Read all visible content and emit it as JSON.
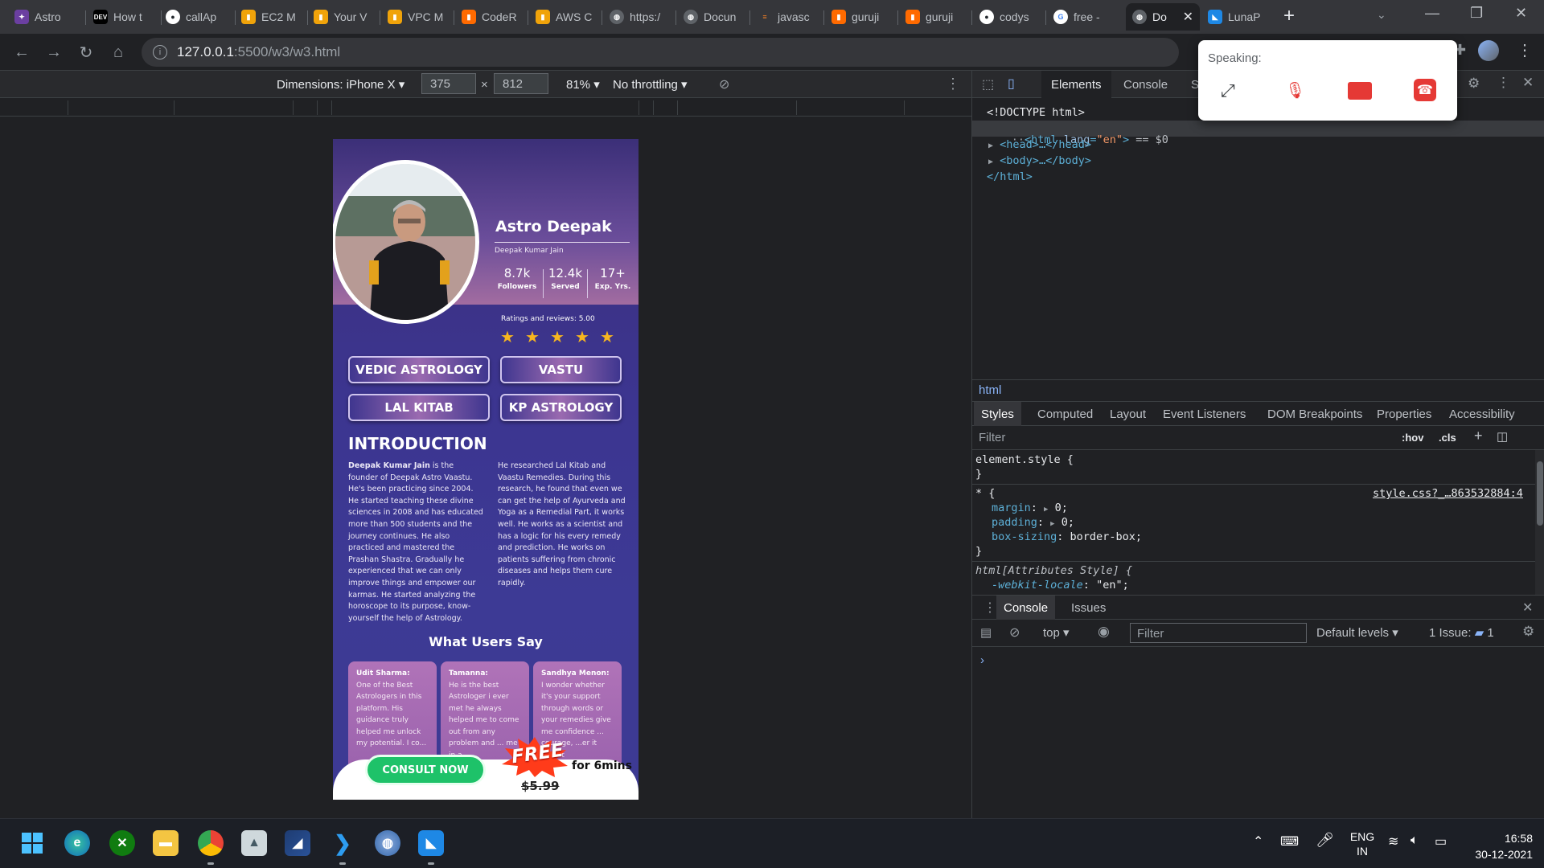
{
  "browser": {
    "tabs": [
      {
        "label": "Astro",
        "icon": "astro-favicon",
        "color": "#6b3fa0"
      },
      {
        "label": "How t",
        "icon": "dev-favicon",
        "color": "#000000"
      },
      {
        "label": "callAp",
        "icon": "github-favicon",
        "color": "#24292e"
      },
      {
        "label": "EC2 M",
        "icon": "aws-favicon",
        "color": "#f0a30a"
      },
      {
        "label": "Your V",
        "icon": "aws-favicon",
        "color": "#f0a30a"
      },
      {
        "label": "VPC M",
        "icon": "aws-favicon",
        "color": "#f0a30a"
      },
      {
        "label": "CodeR",
        "icon": "aws-favicon",
        "color": "#ff6a00"
      },
      {
        "label": "AWS C",
        "icon": "aws-favicon",
        "color": "#f0a30a"
      },
      {
        "label": "https:/",
        "icon": "globe-favicon",
        "color": "#5f6368"
      },
      {
        "label": "Docun",
        "icon": "globe-favicon",
        "color": "#5f6368"
      },
      {
        "label": "javasc",
        "icon": "stackoverflow-favicon",
        "color": "#f48024"
      },
      {
        "label": "guruji",
        "icon": "aws-favicon",
        "color": "#ff6a00"
      },
      {
        "label": "guruji",
        "icon": "aws-favicon",
        "color": "#ff6a00"
      },
      {
        "label": "codys",
        "icon": "github-favicon",
        "color": "#24292e"
      },
      {
        "label": "free -",
        "icon": "google-favicon",
        "color": "#ffffff"
      },
      {
        "label": "Do",
        "icon": "globe-favicon",
        "color": "#5f6368"
      },
      {
        "label": "LunaP",
        "icon": "luna-favicon",
        "color": "#1e88e5"
      }
    ],
    "dev_label": "DEV",
    "new_tab": "+",
    "url_host": "127.0.0.1",
    "url_path": ":5500/w3/w3.html"
  },
  "device_toolbar": {
    "dimensions_label": "Dimensions: iPhone X",
    "width": "375",
    "x": "×",
    "height": "812",
    "zoom": "81%",
    "throttling": "No throttling"
  },
  "page": {
    "name": "Astro Deepak",
    "subname": "Deepak Kumar Jain",
    "stats": [
      {
        "value": "8.7k",
        "label": "Followers"
      },
      {
        "value": "12.4k",
        "label": "Served"
      },
      {
        "value": "17+",
        "label": "Exp. Yrs."
      }
    ],
    "ratings_text": "Ratings and reviews: 5.00",
    "rating_value": 5,
    "stars": [
      "★",
      "★",
      "★",
      "★",
      "★"
    ],
    "services": [
      "VEDIC ASTROLOGY",
      "VASTU",
      "LAL KITAB",
      "KP ASTROLOGY"
    ],
    "intro_heading": "INTRODUCTION",
    "intro_bold": "Deepak Kumar Jain",
    "intro_col1": " is the founder of Deepak Astro Vaastu. He's been practicing since 2004. He started teaching these divine sciences in 2008 and has educated more than 500 students and the journey continues. He also practiced and mastered the Prashan Shastra. Gradually he experienced that we can only improve things and empower our karmas. He started analyzing the horoscope to its purpose, know-yourself the help of Astrology.",
    "intro_col2": "He researched Lal Kitab and Vaastu Remedies. During this research, he found that even we can get the help of Ayurveda and Yoga as a Remedial Part, it works well. He works as a scientist and has a logic for his every remedy and prediction. He works on patients suffering from chronic diseases and helps them cure rapidly.",
    "reviews_heading": "What Users Say",
    "reviews": [
      {
        "name": "Udit Sharma:",
        "text": "One of the Best Astrologers in this platform. His guidance truly helped me unlock my potential. I co..."
      },
      {
        "name": "Tamanna:",
        "text": "He is the best Astrologer i ever met he always helped me to come out from any problem and ... me in a..."
      },
      {
        "name": "Sandhya Menon:",
        "text": "I wonder whether it's your support through words or your remedies give me confidence ... courage, ...er it be... it"
      }
    ],
    "cta": "CONSULT NOW",
    "free": "FREE",
    "for_mins": "for 6mins",
    "old_price": "$5.99"
  },
  "devtools": {
    "tabs": [
      "Elements",
      "Console",
      "S"
    ],
    "dom": {
      "doctype": "<!DOCTYPE html>",
      "html_open_tag": "<html",
      "html_attr_name": "lang",
      "html_attr_value": "\"en\"",
      "html_open_end": ">",
      "selected_marker": "== $0",
      "head": "<head>…</head>",
      "body": "<body>…</body>",
      "html_close": "</html>"
    },
    "breadcrumb": "html",
    "style_tabs": [
      "Styles",
      "Computed",
      "Layout",
      "Event Listeners",
      "DOM Breakpoints",
      "Properties",
      "Accessibility"
    ],
    "filter_placeholder": "Filter",
    "hov": ":hov",
    "cls": ".cls",
    "rules": {
      "element_style": "element.style {",
      "close": "}",
      "universal": "* {",
      "source": "style.css?_…863532884:4",
      "margin": "margin",
      "margin_val": "0;",
      "padding": "padding",
      "padding_val": "0;",
      "box_sizing": "box-sizing",
      "box_sizing_val": "border-box;",
      "attr_style": "html[Attributes Style] {",
      "webkit_locale": "-webkit-locale",
      "webkit_locale_val": "\"en\";"
    },
    "drawer": {
      "tabs": [
        "Console",
        "Issues"
      ],
      "context": "top",
      "filter_placeholder": "Filter",
      "levels": "Default levels",
      "issues": "1 Issue:",
      "issues_count": "1",
      "prompt": "›"
    }
  },
  "speaking": {
    "label": "Speaking:"
  },
  "taskbar": {
    "lang": "ENG",
    "region": "IN",
    "time": "16:58",
    "date": "30-12-2021"
  }
}
